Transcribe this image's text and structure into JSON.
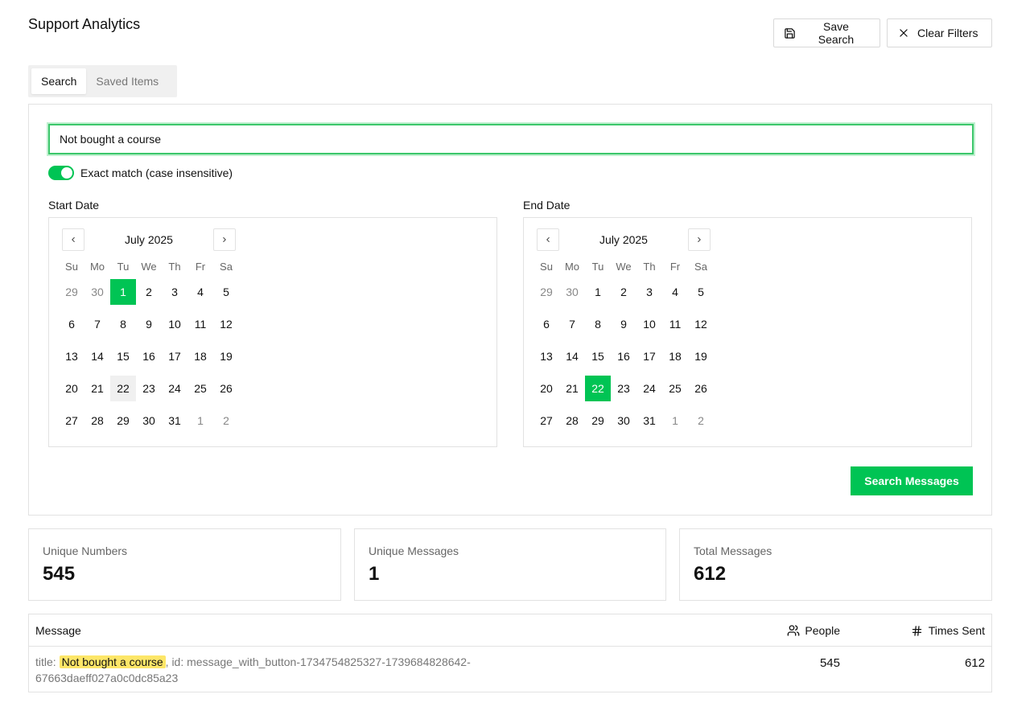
{
  "header": {
    "title": "Support Analytics",
    "save_label": "Save Search",
    "clear_label": "Clear Filters"
  },
  "tabs": [
    {
      "label": "Search",
      "active": true
    },
    {
      "label": "Saved Items",
      "active": false
    }
  ],
  "search": {
    "value": "Not bought a course",
    "exact_match_label": "Exact match (case insensitive)",
    "exact_match_on": true,
    "button_label": "Search Messages"
  },
  "weekdays": [
    "Su",
    "Mo",
    "Tu",
    "We",
    "Th",
    "Fr",
    "Sa"
  ],
  "start_date": {
    "label": "Start Date",
    "month": "July 2025",
    "weeks": [
      [
        "29",
        "30",
        "1",
        "2",
        "3",
        "4",
        "5"
      ],
      [
        "6",
        "7",
        "8",
        "9",
        "10",
        "11",
        "12"
      ],
      [
        "13",
        "14",
        "15",
        "16",
        "17",
        "18",
        "19"
      ],
      [
        "20",
        "21",
        "22",
        "23",
        "24",
        "25",
        "26"
      ],
      [
        "27",
        "28",
        "29",
        "30",
        "31",
        "1",
        "2"
      ]
    ],
    "selected": "1",
    "today": "22"
  },
  "end_date": {
    "label": "End Date",
    "month": "July 2025",
    "weeks": [
      [
        "29",
        "30",
        "1",
        "2",
        "3",
        "4",
        "5"
      ],
      [
        "6",
        "7",
        "8",
        "9",
        "10",
        "11",
        "12"
      ],
      [
        "13",
        "14",
        "15",
        "16",
        "17",
        "18",
        "19"
      ],
      [
        "20",
        "21",
        "22",
        "23",
        "24",
        "25",
        "26"
      ],
      [
        "27",
        "28",
        "29",
        "30",
        "31",
        "1",
        "2"
      ]
    ],
    "selected": "22"
  },
  "stats": {
    "unique_numbers_label": "Unique Numbers",
    "unique_numbers_value": "545",
    "unique_messages_label": "Unique Messages",
    "unique_messages_value": "1",
    "total_messages_label": "Total Messages",
    "total_messages_value": "612"
  },
  "table": {
    "col_message": "Message",
    "col_people": "People",
    "col_times": "Times Sent",
    "rows": [
      {
        "prefix": "title: ",
        "highlight": "Not bought a course",
        "suffix": ", id: message_with_button-1734754825327-1739684828642-67663daeff027a0c0dc85a23",
        "people": "545",
        "times": "612"
      }
    ]
  },
  "colors": {
    "accent": "#00c454",
    "highlight": "#fde668"
  }
}
